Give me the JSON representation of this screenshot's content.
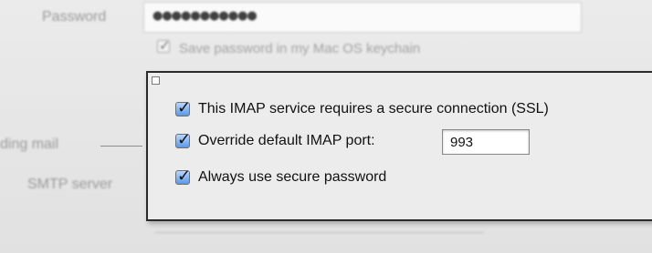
{
  "background_form": {
    "password_label": "Password",
    "password_value": "●●●●●●●●●●●",
    "keychain_label": "Save password in my Mac OS keychain",
    "incoming_label": "ding mail",
    "smtp_label": "SMTP server"
  },
  "popup": {
    "ssl_label": "This IMAP service requires a secure connection (SSL)",
    "ssl_checked": true,
    "port_label": "Override default IMAP port:",
    "port_checked": true,
    "port_value": "993",
    "secure_password_label": "Always use secure password",
    "secure_password_checked": true
  },
  "colors": {
    "checkbox_fill": "#5b98e6",
    "panel_border": "#2a2a2a",
    "panel_bg": "#ececec"
  }
}
